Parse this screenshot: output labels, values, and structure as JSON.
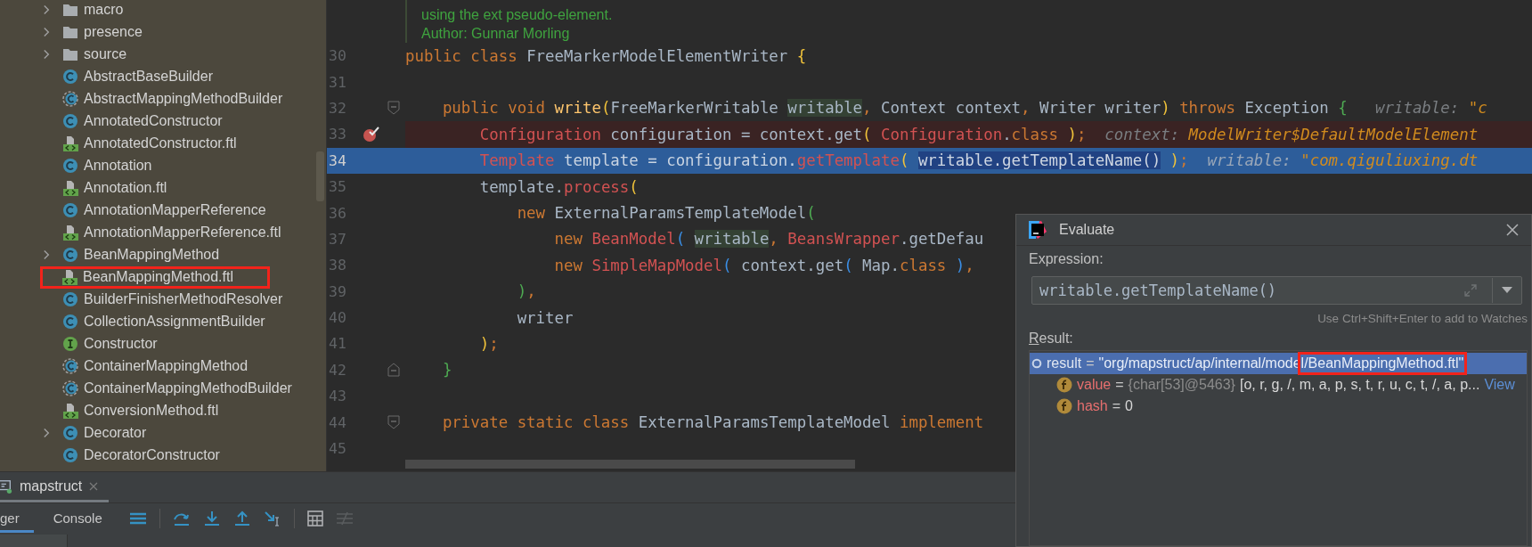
{
  "project_tree": {
    "items": [
      {
        "label": "macro",
        "kind": "folder",
        "has_children": true,
        "marked": false
      },
      {
        "label": "presence",
        "kind": "folder",
        "has_children": true,
        "marked": false
      },
      {
        "label": "source",
        "kind": "folder",
        "has_children": true,
        "marked": false
      },
      {
        "label": "AbstractBaseBuilder",
        "kind": "class",
        "has_children": false,
        "marked": false
      },
      {
        "label": "AbstractMappingMethodBuilder",
        "kind": "abstract",
        "has_children": false,
        "marked": false
      },
      {
        "label": "AnnotatedConstructor",
        "kind": "class",
        "has_children": false,
        "marked": false
      },
      {
        "label": "AnnotatedConstructor.ftl",
        "kind": "template",
        "has_children": false,
        "marked": false
      },
      {
        "label": "Annotation",
        "kind": "class",
        "has_children": false,
        "marked": false
      },
      {
        "label": "Annotation.ftl",
        "kind": "template",
        "has_children": false,
        "marked": false
      },
      {
        "label": "AnnotationMapperReference",
        "kind": "class",
        "has_children": false,
        "marked": false
      },
      {
        "label": "AnnotationMapperReference.ftl",
        "kind": "template",
        "has_children": false,
        "marked": false
      },
      {
        "label": "BeanMappingMethod",
        "kind": "class",
        "has_children": true,
        "marked": false
      },
      {
        "label": "BeanMappingMethod.ftl",
        "kind": "template",
        "has_children": false,
        "marked": true
      },
      {
        "label": "BuilderFinisherMethodResolver",
        "kind": "class",
        "has_children": false,
        "marked": false
      },
      {
        "label": "CollectionAssignmentBuilder",
        "kind": "class",
        "has_children": false,
        "marked": false
      },
      {
        "label": "Constructor",
        "kind": "interface",
        "has_children": false,
        "marked": false
      },
      {
        "label": "ContainerMappingMethod",
        "kind": "abstract",
        "has_children": false,
        "marked": false
      },
      {
        "label": "ContainerMappingMethodBuilder",
        "kind": "abstract",
        "has_children": false,
        "marked": false
      },
      {
        "label": "ConversionMethod.ftl",
        "kind": "template",
        "has_children": false,
        "marked": false
      },
      {
        "label": "Decorator",
        "kind": "class",
        "has_children": true,
        "marked": false
      },
      {
        "label": "DecoratorConstructor",
        "kind": "class",
        "has_children": false,
        "marked": false
      }
    ]
  },
  "editor": {
    "doc_comment": [
      "using the ext pseudo-element.",
      "Author: Gunnar Morling"
    ],
    "lines": [
      {
        "number": "30",
        "kind": "plain",
        "tokens": [
          {
            "t": "public class ",
            "kind": "keyword"
          },
          {
            "t": "FreeMarkerModelElementWriter ",
            "kind": "plain"
          },
          {
            "t": "{",
            "kind": "yellow"
          }
        ]
      },
      {
        "number": "31",
        "kind": "plain"
      },
      {
        "number": "32",
        "kind": "plain",
        "fold": {
          "kind": "start"
        },
        "tokens": [
          {
            "t": "    public void ",
            "kind": "keyword"
          },
          {
            "t": "write",
            "kind": "method"
          },
          {
            "t": "(",
            "kind": "yellow"
          },
          {
            "t": "FreeMarkerWritable ",
            "kind": "plain"
          },
          {
            "t": "writable",
            "kind": "param"
          },
          {
            "t": ", ",
            "kind": "keyword"
          },
          {
            "t": "Context context",
            "kind": "plain"
          },
          {
            "t": ", ",
            "kind": "keyword"
          },
          {
            "t": "Writer writer",
            "kind": "plain"
          },
          {
            "t": ")",
            "kind": "yellow"
          },
          {
            "t": " throws ",
            "kind": "keyword"
          },
          {
            "t": "Exception ",
            "kind": "plain"
          },
          {
            "t": "{   ",
            "kind": "green"
          },
          {
            "t": "writable: ",
            "kind": "hint"
          },
          {
            "t": "\"c",
            "kind": "hintvalue"
          }
        ]
      },
      {
        "number": "33",
        "kind": "breakpoint",
        "tokens": [
          {
            "t": "        Configuration",
            "kind": "type"
          },
          {
            "t": " configuration = context.get",
            "kind": "plain"
          },
          {
            "t": "( ",
            "kind": "yellow"
          },
          {
            "t": "Configuration",
            "kind": "type"
          },
          {
            "t": ".",
            "kind": "plain"
          },
          {
            "t": "class ",
            "kind": "keyword"
          },
          {
            "t": ")",
            "kind": "yellow"
          },
          {
            "t": ";  ",
            "kind": "keyword"
          },
          {
            "t": "context: ",
            "kind": "hint"
          },
          {
            "t": "ModelWriter$DefaultModelElement",
            "kind": "hintvalue"
          }
        ]
      },
      {
        "number": "34",
        "kind": "execution",
        "tokens": [
          {
            "t": "        Template",
            "kind": "type"
          },
          {
            "t": " template = configuration.",
            "kind": "plain"
          },
          {
            "t": "getTemplate",
            "kind": "type"
          },
          {
            "t": "( ",
            "kind": "yellow"
          },
          {
            "t": "writable.getTemplateName()",
            "kind": "selection"
          },
          {
            "t": " )",
            "kind": "yellow"
          },
          {
            "t": ";  ",
            "kind": "keyword"
          },
          {
            "t": "writable: ",
            "kind": "hint"
          },
          {
            "t": "\"com.qiguliuxing.dt",
            "kind": "hintvalue"
          }
        ]
      },
      {
        "number": "35",
        "kind": "plain",
        "tokens": [
          {
            "t": "        template.",
            "kind": "plain"
          },
          {
            "t": "process",
            "kind": "type"
          },
          {
            "t": "(",
            "kind": "yellow"
          }
        ]
      },
      {
        "number": "36",
        "kind": "plain",
        "tokens": [
          {
            "t": "            new ",
            "kind": "keyword"
          },
          {
            "t": "ExternalParamsTemplateModel",
            "kind": "plain"
          },
          {
            "t": "(",
            "kind": "green"
          }
        ]
      },
      {
        "number": "37",
        "kind": "plain",
        "tokens": [
          {
            "t": "                new ",
            "kind": "keyword"
          },
          {
            "t": "BeanModel",
            "kind": "type"
          },
          {
            "t": "( ",
            "kind": "blue"
          },
          {
            "t": "writable",
            "kind": "param"
          },
          {
            "t": ", ",
            "kind": "keyword"
          },
          {
            "t": "BeansWrapper",
            "kind": "type"
          },
          {
            "t": ".getDefau",
            "kind": "plain"
          }
        ]
      },
      {
        "number": "38",
        "kind": "plain",
        "tokens": [
          {
            "t": "                new ",
            "kind": "keyword"
          },
          {
            "t": "SimpleMapModel",
            "kind": "type"
          },
          {
            "t": "(",
            "kind": "blue"
          },
          {
            "t": " context.get",
            "kind": "plain"
          },
          {
            "t": "(",
            "kind": "blue"
          },
          {
            "t": " Map.",
            "kind": "plain"
          },
          {
            "t": "class ",
            "kind": "keyword"
          },
          {
            "t": ")",
            "kind": "blue"
          },
          {
            "t": ",",
            "kind": "keyword"
          }
        ]
      },
      {
        "number": "39",
        "kind": "plain",
        "tokens": [
          {
            "t": "            )",
            "kind": "green"
          },
          {
            "t": ",",
            "kind": "keyword"
          }
        ]
      },
      {
        "number": "40",
        "kind": "plain",
        "tokens": [
          {
            "t": "            writer",
            "kind": "plain"
          }
        ]
      },
      {
        "number": "41",
        "kind": "plain",
        "tokens": [
          {
            "t": "        )",
            "kind": "yellow"
          },
          {
            "t": ";",
            "kind": "keyword"
          }
        ]
      },
      {
        "number": "42",
        "kind": "plain",
        "fold": {
          "kind": "end"
        },
        "tokens": [
          {
            "t": "    }",
            "kind": "green"
          }
        ]
      },
      {
        "number": "43",
        "kind": "plain"
      },
      {
        "number": "44",
        "kind": "plain",
        "fold": {
          "kind": "start"
        },
        "tokens": [
          {
            "t": "    private static class ",
            "kind": "keyword"
          },
          {
            "t": "ExternalParamsTemplateModel ",
            "kind": "plain"
          },
          {
            "t": "implement",
            "kind": "keyword"
          }
        ]
      },
      {
        "number": "45",
        "kind": "plain"
      }
    ]
  },
  "debug_panel": {
    "session_tab": "mapstruct",
    "tabs": [
      {
        "label": "ger",
        "selected": true
      },
      {
        "label": "Console",
        "selected": false
      }
    ]
  },
  "evaluate_dialog": {
    "title": "Evaluate",
    "expression_label": "Expression:",
    "expression": "writable.getTemplateName()",
    "hint": "Use Ctrl+Shift+Enter to add to Watches",
    "result_label": "Result:",
    "results": [
      {
        "name": "result",
        "kind": "object",
        "selected": true,
        "operator": "=",
        "value": [
          {
            "text": "\"org/mapstruct/ap/internal/mode",
            "marked": false
          },
          {
            "text": "l/BeanMappingMethod.ftl\"",
            "marked": true
          }
        ]
      },
      {
        "name": "value",
        "kind": "field",
        "selected": false,
        "operator": "=",
        "type": "{char[53]@5463}",
        "value": [
          {
            "text": "[o, r, g, /, m, a, p, s, t, r, u, c, t, /, a, p...",
            "marked": false
          }
        ],
        "link": "View"
      },
      {
        "name": "hash",
        "kind": "field",
        "selected": false,
        "operator": "=",
        "value": [
          {
            "text": "0",
            "marked": false
          }
        ]
      }
    ]
  }
}
